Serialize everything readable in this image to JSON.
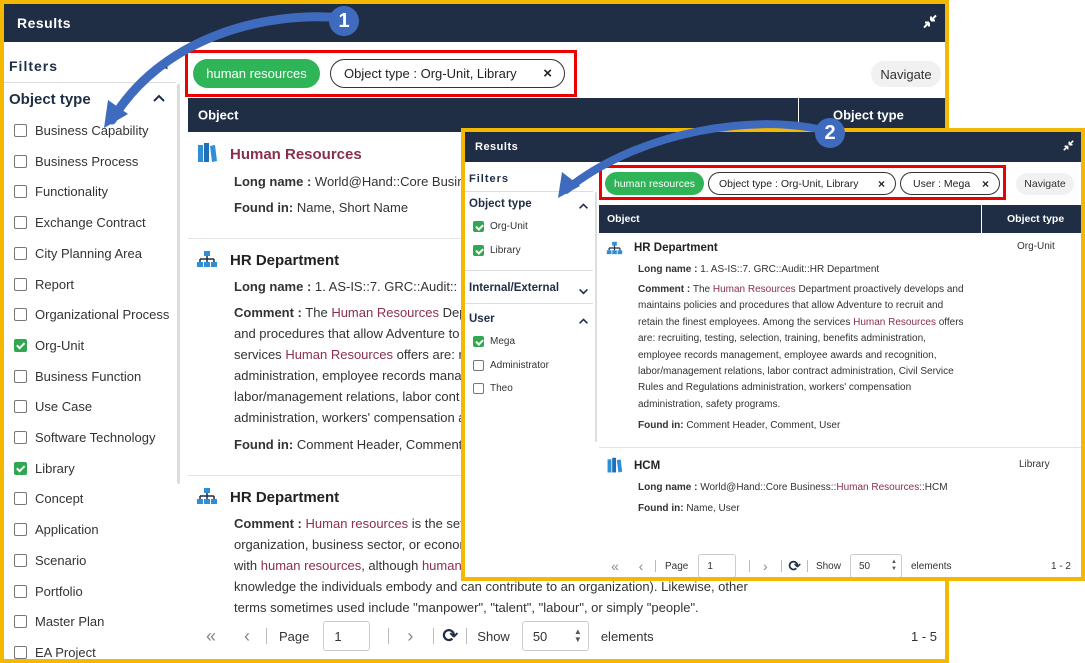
{
  "win1": {
    "title": "Results",
    "filters_title": "Filters",
    "object_type_title": "Object type",
    "object_types": [
      {
        "label": "Business Capability",
        "checked": false
      },
      {
        "label": "Business Process",
        "checked": false
      },
      {
        "label": "Functionality",
        "checked": false
      },
      {
        "label": "Exchange Contract",
        "checked": false
      },
      {
        "label": "City Planning Area",
        "checked": false
      },
      {
        "label": "Report",
        "checked": false
      },
      {
        "label": "Organizational Process",
        "checked": false
      },
      {
        "label": "Org-Unit",
        "checked": true
      },
      {
        "label": "Business Function",
        "checked": false
      },
      {
        "label": "Use Case",
        "checked": false
      },
      {
        "label": "Software Technology",
        "checked": false
      },
      {
        "label": "Library",
        "checked": true
      },
      {
        "label": "Concept",
        "checked": false
      },
      {
        "label": "Application",
        "checked": false
      },
      {
        "label": "Scenario",
        "checked": false
      },
      {
        "label": "Portfolio",
        "checked": false
      },
      {
        "label": "Master Plan",
        "checked": false
      },
      {
        "label": "EA Project",
        "checked": false
      }
    ],
    "chip_search": "human resources",
    "chip_type": "Object type : Org-Unit, Library",
    "chip_close": "×",
    "navigate": "Navigate",
    "col_object": "Object",
    "col_type": "Object type",
    "r1": {
      "title": "Human Resources",
      "ln_label": "Long name :",
      "ln_value": "World@Hand::Core Busin",
      "fi_label": "Found in:",
      "fi_value": "Name, Short Name"
    },
    "r2": {
      "title": "HR Department",
      "ln_label": "Long name :",
      "ln_value": "1. AS-IS::7. GRC::Audit::",
      "c_label": "Comment :",
      "c_a": "The",
      "c_hl1": "Human Resources",
      "c_b": "Dep",
      "c_l2": "and procedures that allow Adventure to",
      "c_l3a": "services",
      "c_hl2": "Human Resources",
      "c_l3b": "offers are: r",
      "c_l4": "administration, employee records mana",
      "c_l5": "labor/management relations, labor cont",
      "c_l6": "administration, workers' compensation a",
      "fi_label": "Found in:",
      "fi_value": "Comment Header, Comment"
    },
    "r3": {
      "title": "HR Department",
      "c_label": "Comment :",
      "c_hl1": "Human resources",
      "c_a": "is the set",
      "c_l2": "organization, business sector, or econom",
      "c_l3a": "with",
      "c_hl2": "human resources",
      "c_l3b": ", although",
      "c_hl3": "human",
      "c_l4": "knowledge the individuals embody and can contribute to an organization). Likewise, other",
      "c_l5": "terms sometimes used include \"manpower\", \"talent\", \"labour\", or simply \"people\"."
    },
    "pager": {
      "first": "«",
      "prev": "‹",
      "page_label": "Page",
      "page_value": "1",
      "next": "›",
      "refresh": "⟳",
      "show_label": "Show",
      "show_value": "50",
      "elements_label": "elements",
      "range": "1 - 5"
    }
  },
  "win2": {
    "title": "Results",
    "filters_title": "Filters",
    "object_type_title": "Object type",
    "object_types": [
      {
        "label": "Org-Unit",
        "checked": true
      },
      {
        "label": "Library",
        "checked": true
      }
    ],
    "internal_title": "Internal/External",
    "user_title": "User",
    "users": [
      {
        "label": "Mega",
        "checked": true
      },
      {
        "label": "Administrator",
        "checked": false
      },
      {
        "label": "Theo",
        "checked": false
      }
    ],
    "chip_search": "human resources",
    "chip_type": "Object type : Org-Unit, Library",
    "chip_user": "User : Mega",
    "chip_close": "×",
    "navigate": "Navigate",
    "col_object": "Object",
    "col_type": "Object type",
    "r1": {
      "title": "HR Department",
      "type": "Org-Unit",
      "ln_label": "Long name :",
      "ln_value": "1. AS-IS::7. GRC::Audit::HR Department",
      "c_label": "Comment :",
      "c_a": "The",
      "c_hl1": "Human Resources",
      "c_b": "Department proactively develops and",
      "c_l2": "maintains policies and procedures that allow Adventure to recruit and",
      "c_l3a": "retain the finest employees. Among the services",
      "c_hl2": "Human Resources",
      "c_l3b": "offers",
      "c_l4": "are: recruiting, testing, selection, training, benefits administration,",
      "c_l5": "employee records management, employee awards and recognition,",
      "c_l6": "labor/management relations, labor contract administration, Civil Service",
      "c_l7": "Rules and Regulations administration, workers' compensation",
      "c_l8": "administration, safety programs.",
      "fi_label": "Found in:",
      "fi_value": "Comment Header, Comment, User"
    },
    "r2": {
      "title": "HCM",
      "type": "Library",
      "ln_label": "Long name :",
      "ln_a": "World@Hand::Core Business::",
      "ln_hl": "Human Resources",
      "ln_b": "::HCM",
      "fi_label": "Found in:",
      "fi_value": "Name, User"
    },
    "pager": {
      "first": "«",
      "prev": "‹",
      "page_label": "Page",
      "page_value": "1",
      "next": "›",
      "refresh": "⟳",
      "show_label": "Show",
      "show_value": "50",
      "elements_label": "elements",
      "range": "1 - 2"
    }
  },
  "callouts": {
    "one": "1",
    "two": "2"
  },
  "colors": {
    "border": "#f5b800",
    "header": "#1f2e45",
    "highlight": "#8a2f4e",
    "chip_green": "#2fb458",
    "check_green": "#2fa84f",
    "red_box": "#e00000",
    "callout": "#3f6bbf"
  }
}
